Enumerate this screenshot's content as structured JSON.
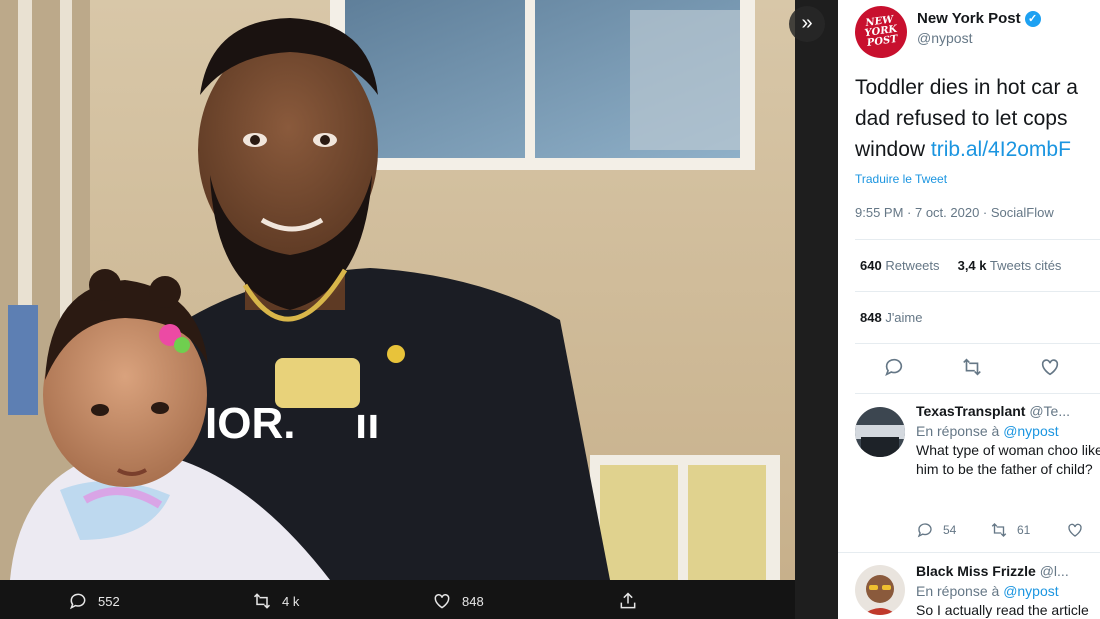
{
  "media": {
    "actions": {
      "replies": "552",
      "retweets": "4 k",
      "likes": "848"
    }
  },
  "tweet": {
    "author_name": "New York Post",
    "author_handle": "@nypost",
    "logo_text": [
      "NEW",
      "YORK",
      "POST"
    ],
    "text_lines": [
      "Toddler dies in hot car a",
      "dad refused to let cops",
      "window "
    ],
    "link": "trib.al/4I2ombF",
    "translate": "Traduire le Tweet",
    "time": "9:55 PM",
    "date": "7 oct. 2020",
    "source": "SocialFlow",
    "retweets_count": "640",
    "retweets_label": "Retweets",
    "quotes_count": "3,4 k",
    "quotes_label": "Tweets cités",
    "likes_count": "848",
    "likes_label": "J'aime"
  },
  "replies": [
    {
      "name": "TexasTransplant",
      "handle": "@Te...",
      "replying_prefix": "En réponse à",
      "replying_to": "@nypost",
      "text": "What type of woman choo like him to be the father of child?",
      "reply_count": "54",
      "retweet_count": "61"
    },
    {
      "name": "Black Miss Frizzle",
      "handle": "@l...",
      "replying_prefix": "En réponse à",
      "replying_to": "@nypost",
      "text": "So I actually read the article"
    }
  ],
  "colors": {
    "accent": "#1b95e0",
    "brand_red": "#c8102e",
    "verified": "#1da1f2"
  }
}
